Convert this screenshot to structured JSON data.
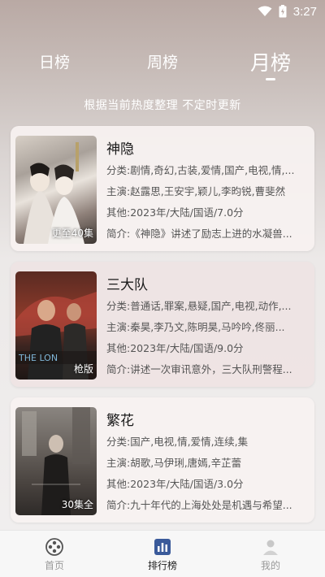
{
  "status": {
    "time": "3:27"
  },
  "tabs": [
    {
      "label": "日榜",
      "active": false
    },
    {
      "label": "周榜",
      "active": false
    },
    {
      "label": "月榜",
      "active": true
    }
  ],
  "subtitle": "根据当前热度整理 不定时更新",
  "cards": [
    {
      "title": "神隐",
      "badge": "更至40集",
      "category_key": "分类:",
      "category": "剧情,奇幻,古装,爱情,国产,电视,情,...",
      "cast_key": "主演:",
      "cast": "赵露思,王安宇,颖儿,李昀锐,曹斐然",
      "other_key": "其他:",
      "other": "2023年/大陆/国语/7.0分",
      "intro_key": "简介:",
      "intro": "《神隐》讲述了励志上进的水凝兽..."
    },
    {
      "title": "三大队",
      "badge": "枪版",
      "category_key": "分类:",
      "category": "普通话,罪案,悬疑,国产,电视,动作,...",
      "cast_key": "主演:",
      "cast": "秦昊,李乃文,陈明昊,马吟吟,佟丽...",
      "other_key": "其他:",
      "other": "2023年/大陆/国语/9.0分",
      "intro_key": "简介:",
      "intro": "讲述一次审讯意外，三大队刑警程..."
    },
    {
      "title": "繁花",
      "badge": "30集全",
      "category_key": "分类:",
      "category": "国产,电视,情,爱情,连续,集",
      "cast_key": "主演:",
      "cast": "胡歌,马伊琍,唐嫣,辛芷蕾",
      "other_key": "其他:",
      "other": "2023年/大陆/国语/3.0分",
      "intro_key": "简介:",
      "intro": "九十年代的上海处处是机遇与希望..."
    }
  ],
  "nav": [
    {
      "label": "首页",
      "icon": "film-reel-icon",
      "active": false
    },
    {
      "label": "排行榜",
      "icon": "chart-icon",
      "active": true
    },
    {
      "label": "我的",
      "icon": "user-icon",
      "active": false
    }
  ]
}
